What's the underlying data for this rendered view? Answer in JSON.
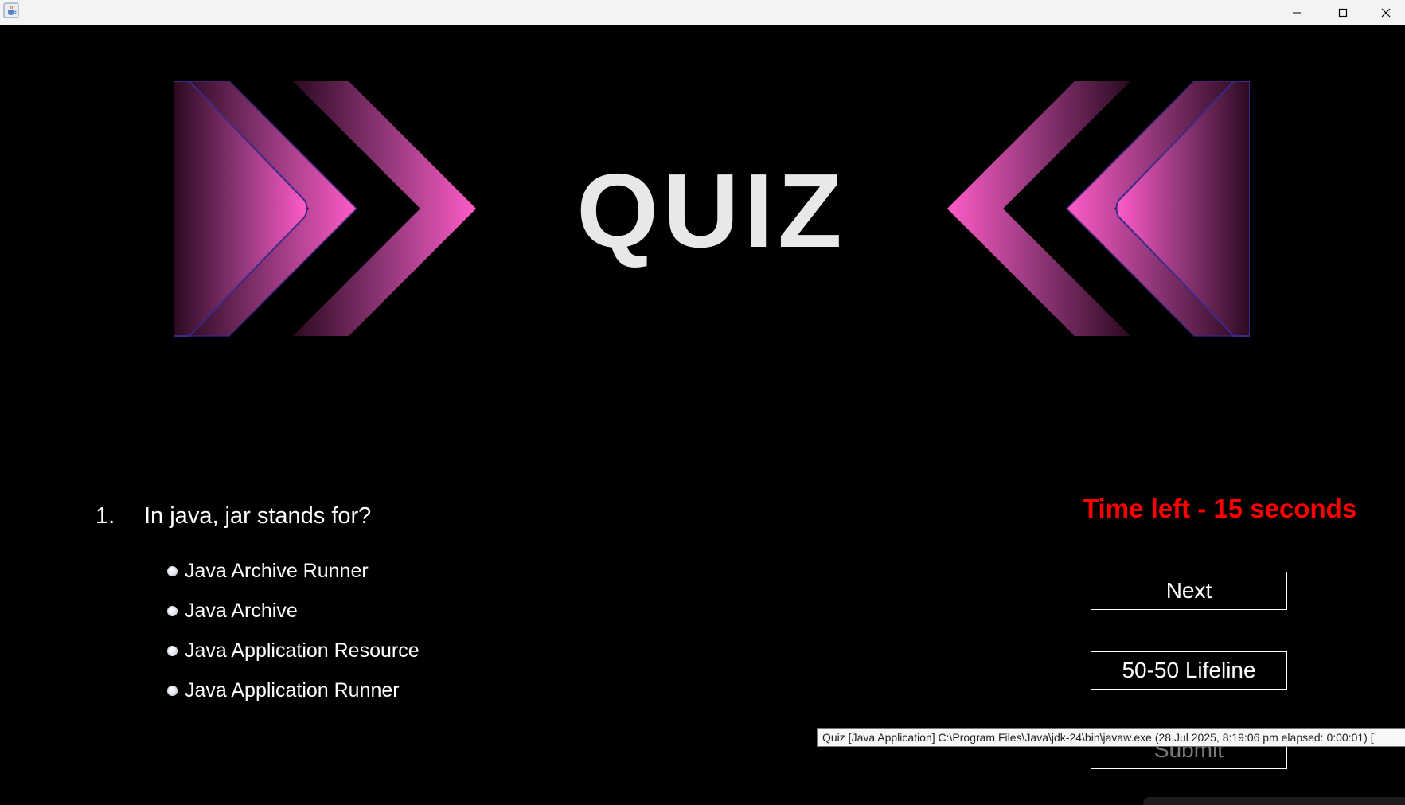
{
  "window": {
    "icon": "java-cup-icon",
    "controls": [
      "minimize-icon",
      "maximize-icon",
      "close-icon"
    ]
  },
  "banner": {
    "title": "QUIZ",
    "accent_color": "#ff5cc8"
  },
  "question": {
    "number": "1.",
    "text": "In java, jar stands for?"
  },
  "options": [
    "Java Archive Runner",
    "Java Archive",
    "Java Application Resource",
    "Java Application Runner"
  ],
  "timer": {
    "text": "Time left - 15 seconds",
    "color": "#ff0000"
  },
  "buttons": {
    "next": "Next",
    "lifeline": "50-50 Lifeline",
    "submit": "Submit"
  },
  "tooltip": {
    "text": "Quiz [Java Application] C:\\Program Files\\Java\\jdk-24\\bin\\javaw.exe  (28 Jul 2025, 8:19:06 pm elapsed: 0:00:01) ["
  }
}
